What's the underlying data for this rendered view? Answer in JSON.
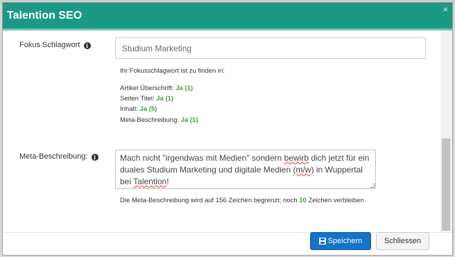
{
  "modal": {
    "title": "Talention SEO",
    "close_glyph": "×"
  },
  "focus": {
    "label": "Fokus Schlagwort",
    "input_value": "Studium Marketing",
    "found_in_intro": "Ihr Fokusschlagwort ist zu finden in:",
    "checks": [
      {
        "label": "Artikel Überschrift:",
        "result": "Ja (1)"
      },
      {
        "label": "Seiten Titel:",
        "result": "Ja (1)"
      },
      {
        "label": "Inhalt:",
        "result": "Ja (5)"
      },
      {
        "label": "Meta-Beschreibung:",
        "result": "Ja (1)"
      }
    ]
  },
  "meta": {
    "label": "Meta-Beschreibung:",
    "text_part1": "Mach nicht \"irgendwas mit Medien\" sondern ",
    "text_misspelled1": "bewirb",
    "text_part2": " dich jetzt für ein duales Studium Marketing und digitale Medien ",
    "text_misspelled2": "(m/w)",
    "text_part3": " in Wuppertal bei ",
    "text_misspelled3": "Talention",
    "text_part4": "!",
    "limit_before": "Die Meta-Beschreibung wird auf 156 Zeichen begrenzt; noch ",
    "limit_remaining": "10",
    "limit_after": " Zeichen verbleiben."
  },
  "footer": {
    "save_label": "Speichern",
    "close_label": "Schliessen"
  },
  "colors": {
    "header": "#1a9a86",
    "success": "#3c9c3c",
    "primary": "#1572c9"
  },
  "icons": {
    "info": "info-icon",
    "save": "floppy-disk-icon",
    "close": "close-icon"
  }
}
